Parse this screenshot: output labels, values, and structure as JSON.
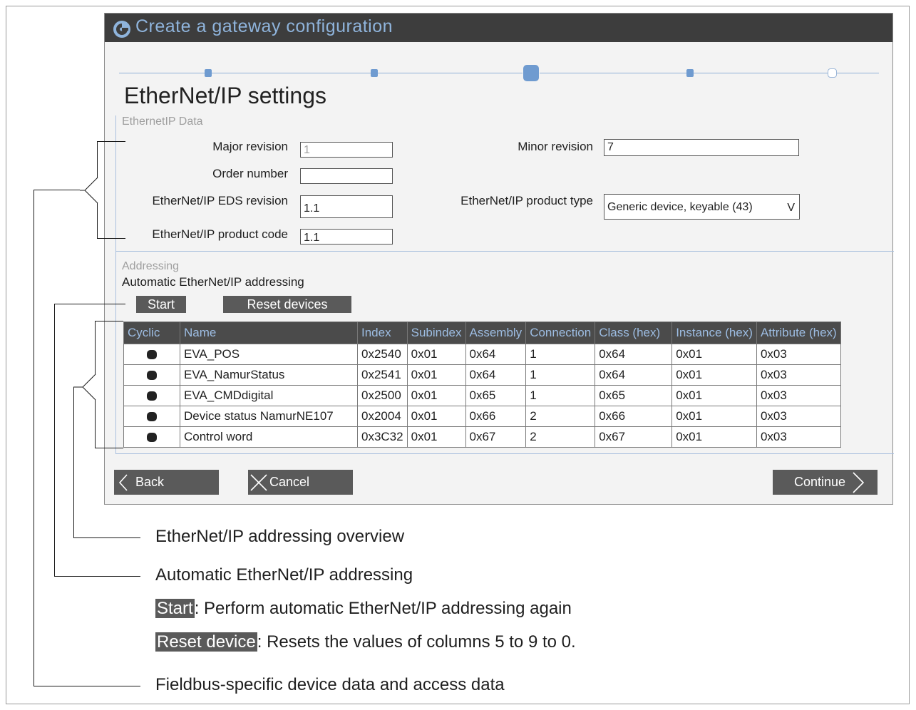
{
  "window": {
    "title": "Create a gateway configuration"
  },
  "page_title": "EtherNet/IP settings",
  "ethernetip_data": {
    "group_label": "EthernetIP Data",
    "major_revision": {
      "label": "Major revision",
      "value": "1"
    },
    "minor_revision": {
      "label": "Minor revision",
      "value": "7"
    },
    "order_number": {
      "label": "Order number",
      "value": ""
    },
    "eds_revision": {
      "label": "EtherNet/IP EDS revision",
      "value": "1.1"
    },
    "product_type": {
      "label": "EtherNet/IP product type",
      "value": "Generic device, keyable (43)",
      "chevron": "V"
    },
    "product_code": {
      "label": "EtherNet/IP product code",
      "value": "1.1"
    }
  },
  "addressing": {
    "group_label": "Addressing",
    "subtitle": "Automatic EtherNet/IP addressing",
    "start_label": "Start",
    "reset_label": "Reset devices",
    "columns": [
      "Cyclic",
      "Name",
      "Index",
      "Subindex",
      "Assembly",
      "Connection",
      "Class (hex)",
      "Instance (hex)",
      "Attribute (hex)"
    ],
    "rows": [
      {
        "cyclic": true,
        "name": "EVA_POS",
        "index": "0x2540",
        "subindex": "0x01",
        "assembly": "0x64",
        "connection": "1",
        "class": "0x64",
        "instance": "0x01",
        "attribute": "0x03"
      },
      {
        "cyclic": true,
        "name": "EVA_NamurStatus",
        "index": "0x2541",
        "subindex": "0x01",
        "assembly": "0x64",
        "connection": "1",
        "class": "0x64",
        "instance": "0x01",
        "attribute": "0x03"
      },
      {
        "cyclic": true,
        "name": "EVA_CMDdigital",
        "index": "0x2500",
        "subindex": "0x01",
        "assembly": "0x65",
        "connection": "1",
        "class": "0x65",
        "instance": "0x01",
        "attribute": "0x03"
      },
      {
        "cyclic": true,
        "name": "Device status NamurNE107",
        "index": "0x2004",
        "subindex": "0x01",
        "assembly": "0x66",
        "connection": "2",
        "class": "0x66",
        "instance": "0x01",
        "attribute": "0x03"
      },
      {
        "cyclic": true,
        "name": "Control word",
        "index": "0x3C32",
        "subindex": "0x01",
        "assembly": "0x67",
        "connection": "2",
        "class": "0x67",
        "instance": "0x01",
        "attribute": "0x03"
      }
    ]
  },
  "nav": {
    "back_label": "Back",
    "cancel_label": "Cancel",
    "continue_label": "Continue"
  },
  "stepper": {
    "steps": 5,
    "current_step": 3
  },
  "legend": {
    "overview": "EtherNet/IP addressing overview",
    "automatic": "Automatic EtherNet/IP addressing",
    "start_key": "Start",
    "start_desc": ": Perform automatic EtherNet/IP addressing again",
    "reset_key": "Reset device",
    "reset_desc": ":  Resets the values of columns 5 to 9 to 0.",
    "fieldbus": "Fieldbus-specific device data and access data"
  },
  "colors": {
    "titlebar": "#3d3d3d",
    "title_text": "#8fb4dc",
    "accent": "#6f9bd0",
    "button": "#5a5a5a",
    "header_text": "#9dbde3"
  }
}
